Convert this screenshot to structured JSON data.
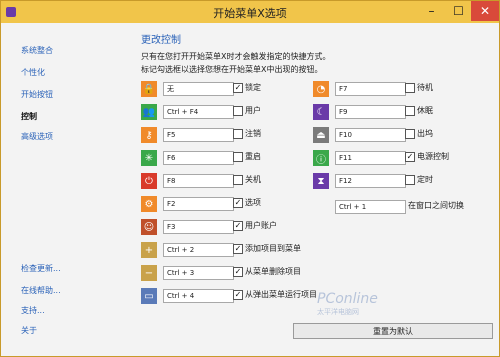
{
  "window": {
    "title": "开始菜单X选项"
  },
  "titlebar": {
    "min": "–",
    "max": "☐",
    "close": "✕"
  },
  "sidebar": {
    "items": [
      {
        "label": "系统整合"
      },
      {
        "label": "个性化"
      },
      {
        "label": "开始按钮"
      },
      {
        "label": "控制"
      },
      {
        "label": "高级选项"
      }
    ],
    "bottom_items": [
      {
        "label": "检查更新..."
      },
      {
        "label": "在线帮助..."
      },
      {
        "label": "支持..."
      },
      {
        "label": "关于"
      }
    ]
  },
  "main": {
    "heading": "更改控制",
    "desc1": "只有在您打开开始菜单X时才会触发指定的快捷方式。",
    "desc2": "标记勾选框以选择您想在开始菜单X中出现的按钮。",
    "left_rows": [
      {
        "icon": "lock-icon",
        "color": "#f08a2a",
        "value": "无",
        "checked": true,
        "checkmark": "✓",
        "label": "锁定"
      },
      {
        "icon": "user-icon",
        "color": "#3aa84a",
        "value": "Ctrl + F4",
        "checked": false,
        "checkmark": "",
        "label": "用户"
      },
      {
        "icon": "key-icon",
        "color": "#f08a2a",
        "value": "F5",
        "checked": false,
        "checkmark": "",
        "label": "注销"
      },
      {
        "icon": "restart-icon",
        "color": "#3aa84a",
        "value": "F6",
        "checked": false,
        "checkmark": "",
        "label": "重启"
      },
      {
        "icon": "power-icon",
        "color": "#d93a2a",
        "value": "F8",
        "checked": false,
        "checkmark": "",
        "label": "关机"
      },
      {
        "icon": "settings-icon",
        "color": "#f08a2a",
        "value": "F2",
        "checked": true,
        "checkmark": "✓",
        "label": "选项"
      },
      {
        "icon": "avatar-icon",
        "color": "#c0502a",
        "value": "F3",
        "checked": true,
        "checkmark": "✓",
        "label": "用户账户"
      },
      {
        "icon": "add-to-menu-icon",
        "color": "#c9a24a",
        "value": "Ctrl + 2",
        "checked": true,
        "checkmark": "✓",
        "label": "添加项目到菜单"
      },
      {
        "icon": "remove-from-menu-icon",
        "color": "#c9a24a",
        "value": "Ctrl + 3",
        "checked": true,
        "checkmark": "✓",
        "label": "从菜单删除项目"
      },
      {
        "icon": "run-icon",
        "color": "#5a7ab8",
        "value": "Ctrl + 4",
        "checked": true,
        "checkmark": "✓",
        "label": "从弹出菜单运行项目"
      }
    ],
    "right_rows": [
      {
        "icon": "standby-icon",
        "color": "#f08a2a",
        "value": "F7",
        "checked": false,
        "checkmark": "",
        "label": "待机"
      },
      {
        "icon": "sleep-icon",
        "color": "#6a3aa8",
        "value": "F9",
        "checked": false,
        "checkmark": "",
        "label": "休眠"
      },
      {
        "icon": "eject-icon",
        "color": "#7a7a7a",
        "value": "F10",
        "checked": false,
        "checkmark": "",
        "label": "出坞"
      },
      {
        "icon": "power-control-icon",
        "color": "#3aa84a",
        "value": "F11",
        "checked": true,
        "checkmark": "✓",
        "label": "电源控制"
      },
      {
        "icon": "timer-icon",
        "color": "#6a3aa8",
        "value": "F12",
        "checked": false,
        "checkmark": "",
        "label": "定时"
      }
    ],
    "switch_row": {
      "value": "Ctrl + 1",
      "label": "在窗口之间切换"
    },
    "reset_button": "重置为默认"
  },
  "watermark": {
    "line1": "PConline",
    "line2": "太平洋电脑网"
  }
}
